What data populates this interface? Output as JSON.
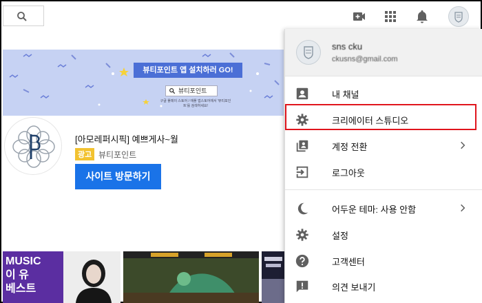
{
  "topbar": {
    "icons": [
      "search-icon",
      "video-camera-icon",
      "apps-grid-icon",
      "bell-icon",
      "account-avatar-icon"
    ]
  },
  "ad": {
    "banner_pill": "뷰티포인트 앱 설치하러 GO!",
    "banner_search": "뷰티포인트",
    "banner_sub": "구글 플레이 스토어 / 애플 앱스토어에서 '뷰티포인트'를 검색하세요!",
    "title": "[아모레퍼시픽] 예쁘게사~월",
    "badge": "광고",
    "sponsor": "뷰티포인트",
    "button": "사이트 방문하기"
  },
  "thumbnails": {
    "t1_line1": "MUSIC",
    "t1_line2": "이 유",
    "t1_line3": "베스트"
  },
  "account_menu": {
    "name": "sns cku",
    "email": "ckusns@gmail.com",
    "items": [
      {
        "label": "내 채널",
        "icon": "person-box-icon"
      },
      {
        "label": "크리에이터 스튜디오",
        "icon": "gear-icon"
      },
      {
        "label": "계정 전환",
        "icon": "switch-account-icon"
      },
      {
        "label": "로그아웃",
        "icon": "logout-icon"
      },
      {
        "label": "어두운 테마: 사용 안함",
        "icon": "moon-icon"
      },
      {
        "label": "설정",
        "icon": "gear-icon"
      },
      {
        "label": "고객센터",
        "icon": "help-icon"
      },
      {
        "label": "의견 보내기",
        "icon": "feedback-icon"
      }
    ]
  },
  "colors": {
    "accent_blue": "#1a73e8",
    "highlight_red": "#e0141c",
    "ad_yellow": "#f2c230"
  }
}
